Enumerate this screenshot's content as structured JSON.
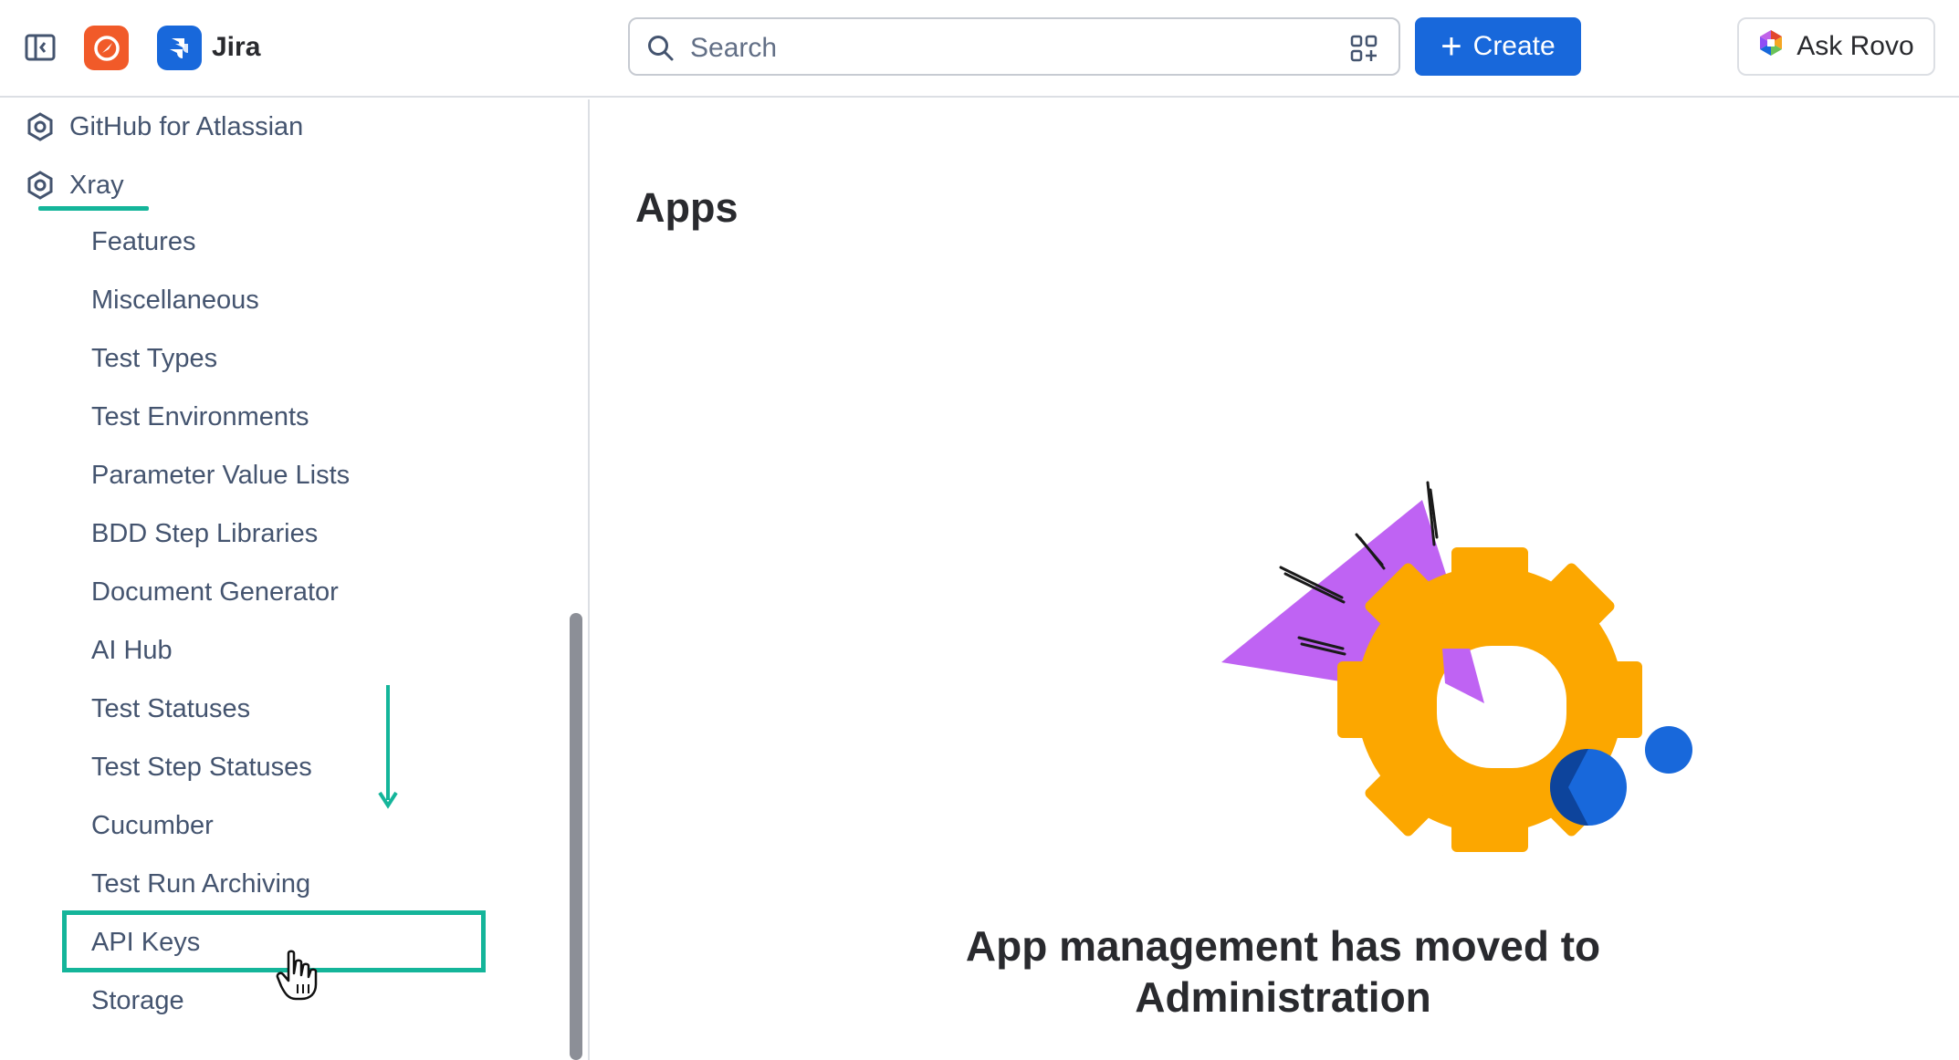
{
  "header": {
    "product_name": "Jira",
    "search_placeholder": "Search",
    "create_label": "Create",
    "rovo_label": "Ask Rovo",
    "colors": {
      "primary": "#1868db",
      "app_logo": "#f15a29"
    }
  },
  "sidebar": {
    "top_items": [
      {
        "label": "GitHub for Atlassian",
        "icon": "hexagon-app-icon"
      },
      {
        "label": "Xray",
        "icon": "hexagon-app-icon"
      }
    ],
    "xray_items": [
      {
        "label": "Features"
      },
      {
        "label": "Miscellaneous"
      },
      {
        "label": "Test Types"
      },
      {
        "label": "Test Environments"
      },
      {
        "label": "Parameter Value Lists"
      },
      {
        "label": "BDD Step Libraries"
      },
      {
        "label": "Document Generator"
      },
      {
        "label": "AI Hub"
      },
      {
        "label": "Test Statuses"
      },
      {
        "label": "Test Step Statuses"
      },
      {
        "label": "Cucumber"
      },
      {
        "label": "Test Run Archiving"
      },
      {
        "label": "API Keys"
      },
      {
        "label": "Storage"
      }
    ],
    "annotation_color": "#14b59a"
  },
  "main": {
    "page_title": "Apps",
    "moved_line1": "App management has moved to",
    "moved_line2": "Administration"
  }
}
